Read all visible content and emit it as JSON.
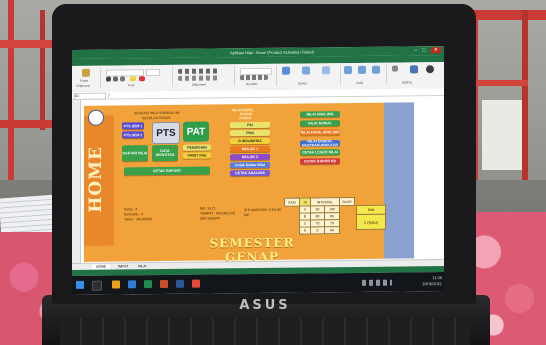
{
  "window": {
    "title": "Aplikasi Nilai - Excel (Product Activation Failed)",
    "controls": [
      "–",
      "□",
      "✕"
    ]
  },
  "menu": [
    "FILE",
    "HOME",
    "INSERT",
    "PAGE LAYOUT",
    "FORMULAS",
    "DATA",
    "REVIEW",
    "VIEW",
    "DEVELOPER"
  ],
  "ribbon": {
    "groups": [
      "Clipboard",
      "Font",
      "Alignment",
      "Number",
      "Styles",
      "Cells",
      "Editing"
    ],
    "buttons": [
      "Paste",
      "Conditional Formatting",
      "Format as Table",
      "Cell Styles",
      "Insert",
      "Delete",
      "Format",
      "Sort & Filter",
      "Find & Select"
    ]
  },
  "formula_bar": {
    "name_box": "A1",
    "value": ""
  },
  "dashboard": {
    "home_label": "HOME",
    "school_header": [
      "APLIKASI NILAI KURIKULUM",
      "SEKOLAH DASAR"
    ],
    "left_buttons": [
      "PTS SEM 1",
      "PTS SEM 2",
      "DAFTAR NILAI",
      "DATA IDENTITAS"
    ],
    "pts_label": "PTS",
    "pat_label": "PAT",
    "small_buttons": [
      "PENGISIAN",
      "PRINT PAS",
      "PRINT RAPOR"
    ],
    "bottom_left_button": "CETAK RAPORT",
    "middle_title": [
      "NILAI MAPEL",
      "RUANG",
      "TUGAS"
    ],
    "middle_buttons": [
      "PAI",
      "PKN",
      "B.INDONESIA",
      "MULOK 1",
      "MULOK 2",
      "Cetak Daftar Nilai",
      "CETAK ANALISIS"
    ],
    "right_buttons": [
      "NILAI ANALISIS",
      "NILAI SOSIAL",
      "NILAI HASIL ANALISIS",
      "NILAI EKSKUL EKSTRAKURIKULER",
      "CETAK LEGER NILAI",
      "CETAK RAPOR KD"
    ],
    "info_left": [
      "Kelas : 4",
      "Semester : II",
      "Tahun : 2019/2020"
    ],
    "info_mid": [
      "NIP. 19.71",
      "TEMPAT : WALIKELAS",
      "SMT GENAP"
    ],
    "teacher": [
      "SITI MARYUNI, S.Pd.SD",
      "NIP."
    ],
    "kkm": {
      "headers": [
        "KKM",
        "70",
        "INTERVAL",
        "SKOR"
      ],
      "rows": [
        [
          "A",
          "90",
          "100"
        ],
        [
          "B",
          "80",
          "89"
        ],
        [
          "C",
          "70",
          "79"
        ],
        [
          "D",
          "0",
          "69"
        ]
      ],
      "side_label": "Nilai",
      "side_value": "1 (Satu)"
    },
    "semester_label": "SEMESTER GENAP"
  },
  "sheet_tabs": [
    "HOME",
    "INPUT",
    "NILAI"
  ],
  "taskbar": {
    "time": "11:36",
    "date": "10/06/2021"
  },
  "laptop_brand": "ASUS",
  "colors": {
    "excel_green": "#217346",
    "dashboard_orange": "#f2a23a",
    "taskbar": "#121519"
  }
}
